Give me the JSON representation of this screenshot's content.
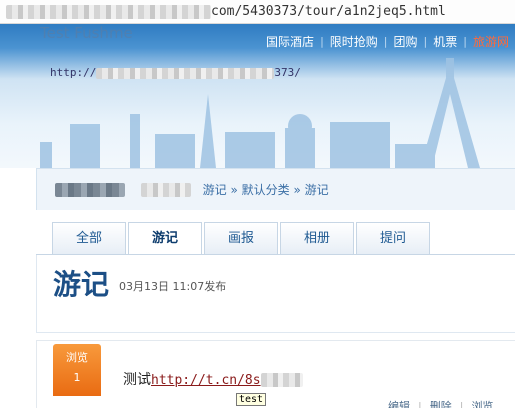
{
  "addressbar": {
    "url_visible": "com/5430373/tour/a1n2jeq5.html"
  },
  "header": {
    "brand": "Test Fushme",
    "nav": [
      {
        "label": "国际酒店",
        "hot": false
      },
      {
        "label": "限时抢购",
        "hot": false
      },
      {
        "label": "团购",
        "hot": false
      },
      {
        "label": "机票",
        "hot": false
      },
      {
        "label": "旅游网",
        "hot": true
      }
    ],
    "site_url_prefix": "http://",
    "site_url_suffix": "373/"
  },
  "breadcrumb": {
    "path": "游记 » 默认分类 » 游记"
  },
  "tabs": [
    {
      "label": "全部",
      "active": false
    },
    {
      "label": "游记",
      "active": true
    },
    {
      "label": "画报",
      "active": false
    },
    {
      "label": "相册",
      "active": false
    },
    {
      "label": "提问",
      "active": false
    }
  ],
  "page": {
    "title": "游记",
    "date": "03月13日 11:07发布"
  },
  "post": {
    "badge_label": "浏览",
    "badge_count": "1",
    "text_prefix": "测试",
    "link_text": "http://t.cn/8s",
    "tooltip": "test",
    "actions": [
      "编辑",
      "删除",
      "浏览"
    ]
  },
  "colors": {
    "header_blue": "#2f7cc2",
    "hot_nav": "#ff6a3a",
    "title_blue": "#1c4f86",
    "badge_orange": "#e96b12"
  }
}
